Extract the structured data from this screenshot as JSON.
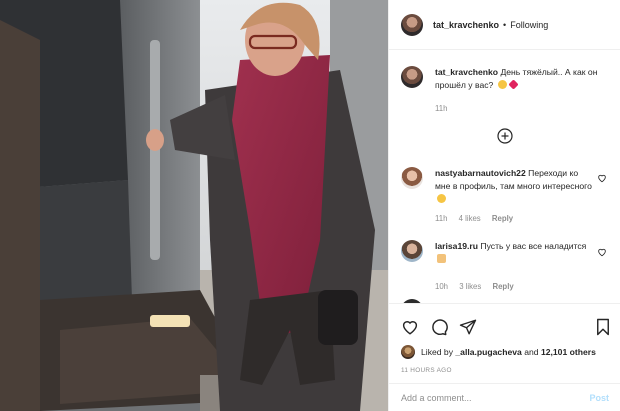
{
  "post": {
    "author": "tat_kravchenko",
    "follow_status": "Following",
    "separator": "•"
  },
  "caption": {
    "author": "tat_kravchenko",
    "text": "День тяжёлый.. А как он прошёл у вас?",
    "time": "11h"
  },
  "comments": [
    {
      "username": "nastyabarnautovich22",
      "text": "Переходи ко мне в профиль, там много интересного",
      "time": "11h",
      "likes": "4 likes",
      "reply": "Reply"
    },
    {
      "username": "larisa19.ru",
      "text": "Пусть у вас все наладится",
      "time": "10h",
      "likes": "3 likes",
      "reply": "Reply"
    }
  ],
  "likes": {
    "prefix": "Liked by",
    "first_liker": "_alla.pugacheva",
    "middle": "and",
    "others": "12,101 others"
  },
  "timestamp": "11 HOURS AGO",
  "composer": {
    "placeholder": "Add a comment...",
    "post_label": "Post"
  },
  "icons": {
    "like": "heart-icon",
    "comment": "comment-icon",
    "share": "share-icon",
    "save": "bookmark-icon",
    "load_more": "plus-circle-icon"
  }
}
